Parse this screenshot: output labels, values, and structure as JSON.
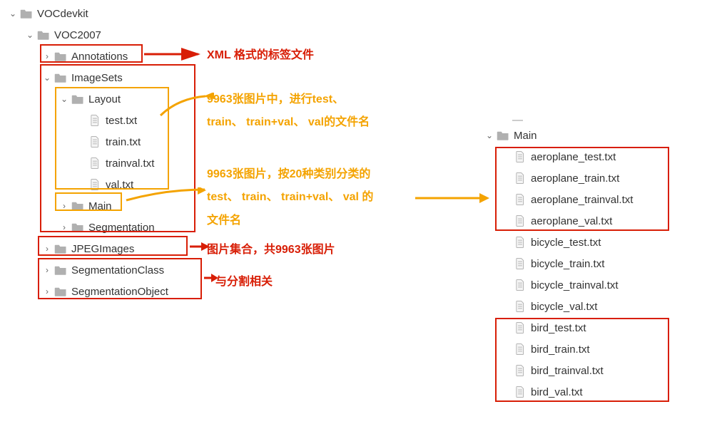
{
  "leftTree": {
    "root": "VOCdevkit",
    "voc": "VOC2007",
    "annotations": "Annotations",
    "imageSets": "ImageSets",
    "layout": "Layout",
    "layoutFiles": [
      "test.txt",
      "train.txt",
      "trainval.txt",
      "val.txt"
    ],
    "main": "Main",
    "segmentation": "Segmentation",
    "jpeg": "JPEGImages",
    "segClass": "SegmentationClass",
    "segObj": "SegmentationObject"
  },
  "rightTree": {
    "main": "Main",
    "files": [
      "aeroplane_test.txt",
      "aeroplane_train.txt",
      "aeroplane_trainval.txt",
      "aeroplane_val.txt",
      "bicycle_test.txt",
      "bicycle_train.txt",
      "bicycle_trainval.txt",
      "bicycle_val.txt",
      "bird_test.txt",
      "bird_train.txt",
      "bird_trainval.txt",
      "bird_val.txt"
    ]
  },
  "ann": {
    "xml": "XML 格式的标签文件",
    "layout1": "9963张图片中，进行test、",
    "layout2": "train、 train+val、 val的文件名",
    "main1": "9963张图片，按20种类别分类的",
    "main2": "test、 train、 train+val、 val 的",
    "main3": "文件名",
    "jpeg": "图片集合，共9963张图片",
    "seg": "与分割相关"
  }
}
